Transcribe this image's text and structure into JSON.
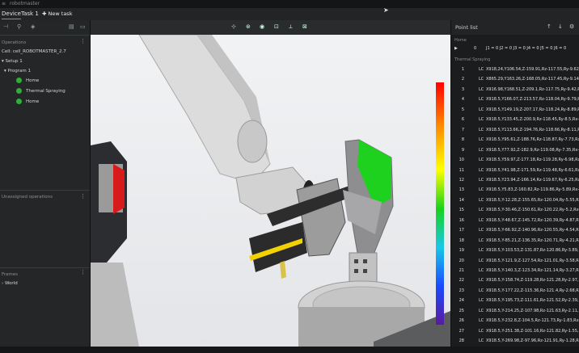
{
  "app": {
    "title": "robotmaster",
    "menu_icon": "hamburger-menu-icon"
  },
  "tabs": {
    "device": "Device",
    "task": "Task 1",
    "new_task": "New task"
  },
  "left": {
    "operations_title": "Operations",
    "cell": "Cell: cell_ROBOTMASTER_2.7",
    "setup": "Setup 1",
    "program": "Program 1",
    "ops": [
      "Home",
      "Thermal Spraying",
      "Home"
    ],
    "unassigned_title": "Unassigned operations",
    "frames_title": "Frames",
    "world": "World"
  },
  "right": {
    "title": "Point list",
    "home_label": "Home",
    "home_row": {
      "num": "0",
      "code": "J1 = 0  J2 = 0  J3 = 0  J4 = 0  J5 = 0  J6 = 0"
    },
    "thermal_label": "Thermal Spraying",
    "rows": [
      {
        "n": "1",
        "t": "LC",
        "c": "X918,24,Y106.54,Z-159.91,Rz-117.55,Ry-9.62,Rx-"
      },
      {
        "n": "2",
        "t": "LC",
        "c": "X865.29,Y163.26,Z-168.05,Rz-117.45,Ry-9.14,Rx-"
      },
      {
        "n": "3",
        "t": "LC",
        "c": "X916.98,Y168.51,Z-209.1,Rz-117.75,Ry-9.42,Rx-15"
      },
      {
        "n": "4",
        "t": "LC",
        "c": "X918.5,Y166.07,Z-213.57,Rz-118.04,Ry-9.79,Rx-15"
      },
      {
        "n": "5",
        "t": "LC",
        "c": "X918.5,Y149.19,Z-207.17,Rz-118.24,Ry-8.89,Rx-15"
      },
      {
        "n": "6",
        "t": "LC",
        "c": "X918.5,Y133.45,Z-200.9,Rz-118.45,Ry-8.5,Rx-155."
      },
      {
        "n": "7",
        "t": "LC",
        "c": "X918.5,Y113.66,Z-194.76,Rz-118.66,Ry-8.11,Rx-15"
      },
      {
        "n": "8",
        "t": "LC",
        "c": "X918.5,Y95.61,Z-188.76,Rz-118.87,Ry-7.73,Rx-15"
      },
      {
        "n": "9",
        "t": "LC",
        "c": "X918.5,Y77.92,Z-182.9,Rz-119.08,Ry-7.35,Rx-156."
      },
      {
        "n": "10",
        "t": "LC",
        "c": "X918.5,Y59.97,Z-177.18,Rz-119.28,Ry-6.98,Rx-15"
      },
      {
        "n": "11",
        "t": "LC",
        "c": "X918.5,Y41.98,Z-171.59,Rz-119.48,Ry-6.61,Rx-15"
      },
      {
        "n": "12",
        "t": "LC",
        "c": "X918.5,Y23.94,Z-166.14,Rz-119.67,Ry-6.25,Rx-15"
      },
      {
        "n": "13",
        "t": "LC",
        "c": "X918.5,Y5.83,Z-160.82,Rz-119.86,Ry-5.89,Rx-158."
      },
      {
        "n": "14",
        "t": "LC",
        "c": "X918.5,Y-12.28,Z-155.65,Rz-120.04,Ry-5.55,Rx-15"
      },
      {
        "n": "15",
        "t": "LC",
        "c": "X918.5,Y-30.46,Z-150.61,Rz-120.22,Ry-5.2,Rx-159"
      },
      {
        "n": "16",
        "t": "LC",
        "c": "X918.5,Y-48.67,Z-145.72,Rz-120.39,Ry-4.87,Rx-15"
      },
      {
        "n": "17",
        "t": "LC",
        "c": "X918.5,Y-66.92,Z-140.96,Rz-120.55,Ry-4.54,Rx-15"
      },
      {
        "n": "18",
        "t": "LC",
        "c": "X918.5,Y-85.21,Z-136.35,Rz-120.71,Ry-4.21,Rx-16"
      },
      {
        "n": "19",
        "t": "LC",
        "c": "X918.5,Y-103.53,Z-131.87,Rz-120.86,Ry-3.89,Rx-1"
      },
      {
        "n": "20",
        "t": "LC",
        "c": "X918.5,Y-121.9,Z-127.54,Rz-121.01,Ry-3.58,Rx-16"
      },
      {
        "n": "21",
        "t": "LC",
        "c": "X918.5,Y-140.3,Z-123.34,Rz-121.14,Ry-3.27,Rx-16"
      },
      {
        "n": "22",
        "t": "LC",
        "c": "X918.5,Y-158.74,Z-119.28,Rz-121.28,Ry-2.97,Rx-1"
      },
      {
        "n": "23",
        "t": "LC",
        "c": "X918.5,Y-177.22,Z-115.36,Rz-121.4,Ry-2.68,Rx-16"
      },
      {
        "n": "24",
        "t": "LC",
        "c": "X918.5,Y-195.73,Z-111.61,Rz-121.52,Ry-2.39,Rx-1"
      },
      {
        "n": "25",
        "t": "LC",
        "c": "X918.5,Y-214.25,Z-107.98,Rz-121.63,Ry-2.11,Rx-1"
      },
      {
        "n": "26",
        "t": "LC",
        "c": "X918.5,Y-232.8,Z-104.5,Rz-121.73,Ry-1.83,Rx-163"
      },
      {
        "n": "27",
        "t": "LC",
        "c": "X918.5,Y-251.38,Z-101.16,Rz-121.82,Ry-1.55,Rx-1"
      },
      {
        "n": "28",
        "t": "LC",
        "c": "X918.5,Y-269.98,Z-97.96,Rz-121.91,Ry-1.28,Rx-16"
      }
    ]
  },
  "colors": {
    "accent": "#4aa3df",
    "status_dot": "#2fae3a",
    "spray_coverage": "#1fd11f",
    "part_stripe": "#f2d200"
  },
  "colorbar": {
    "stops": [
      "#ff0000",
      "#ff8a00",
      "#ffff00",
      "#19d319",
      "#18c8e8",
      "#1a4bff",
      "#5a1aa0"
    ]
  }
}
